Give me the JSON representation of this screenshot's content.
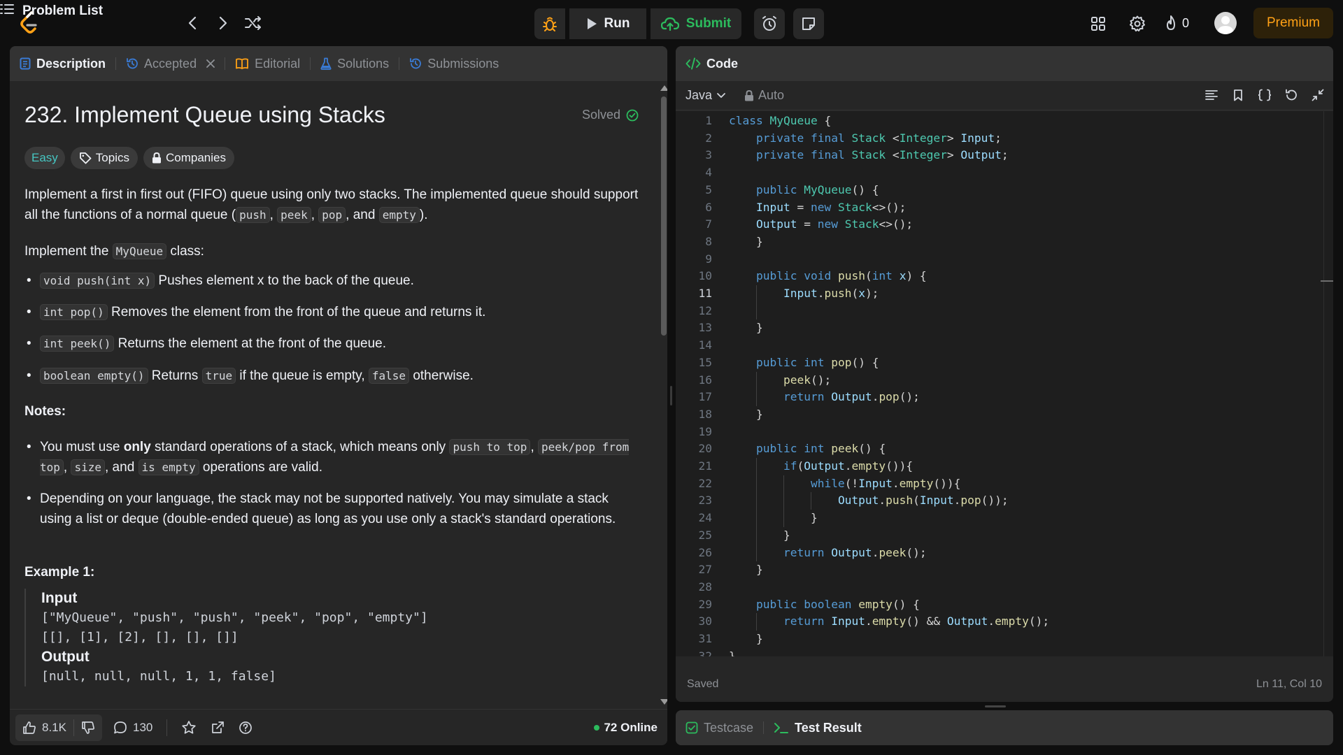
{
  "nav": {
    "problem_list": "Problem List",
    "run": "Run",
    "submit": "Submit",
    "streak_count": "0",
    "premium": "Premium"
  },
  "left_tabs": [
    {
      "label": "Description",
      "active": true
    },
    {
      "label": "Accepted",
      "active": false
    },
    {
      "label": "Editorial",
      "active": false
    },
    {
      "label": "Solutions",
      "active": false
    },
    {
      "label": "Submissions",
      "active": false
    }
  ],
  "problem": {
    "title": "232. Implement Queue using Stacks",
    "status": "Solved",
    "difficulty": "Easy",
    "topics": "Topics",
    "companies": "Companies",
    "intro_1": "Implement a first in first out (FIFO) queue using only two stacks. The implemented queue should support all the functions of a normal queue (",
    "code_push": "push",
    "code_peek": "peek",
    "code_pop": "pop",
    "code_empty": "empty",
    "intro_sep": ", ",
    "intro_and": ", and ",
    "intro_end": ").",
    "implement_pre": "Implement the ",
    "class_name": "MyQueue",
    "implement_post": " class:",
    "methods": [
      {
        "code": "void push(int x)",
        "text": " Pushes element x to the back of the queue."
      },
      {
        "code": "int pop()",
        "text": " Removes the element from the front of the queue and returns it."
      },
      {
        "code": "int peek()",
        "text": " Returns the element at the front of the queue."
      }
    ],
    "empty_method": {
      "code": "boolean empty()",
      "pre": " Returns ",
      "true": "true",
      "mid": " if the queue is empty, ",
      "false": "false",
      "post": " otherwise."
    },
    "notes_title": "Notes:",
    "note1": {
      "pre": "You must use ",
      "bold": "only",
      "mid": " standard operations of a stack, which means only ",
      "c1": "push to top",
      "sep1": ", ",
      "c2": "peek/pop from top",
      "sep2": ", ",
      "c3": "size",
      "and": ", and ",
      "c4": "is empty",
      "post": " operations are valid."
    },
    "note2": "Depending on your language, the stack may not be supported natively. You may simulate a stack using a list or deque (double-ended queue) as long as you use only a stack's standard operations.",
    "example_title": "Example 1:",
    "input_label": "Input",
    "input_line1": "[\"MyQueue\", \"push\", \"push\", \"peek\", \"pop\", \"empty\"]",
    "input_line2": "[[], [1], [2], [], [], []]",
    "output_label": "Output",
    "output_line": "[null, null, null, 1, 1, false]"
  },
  "footer": {
    "likes": "8.1K",
    "comments": "130",
    "online": "72 Online"
  },
  "code_panel": {
    "title": "Code",
    "language": "Java",
    "mode": "Auto",
    "saved": "Saved",
    "cursor": "Ln 11, Col 10",
    "current_line": 11
  },
  "code_lines": [
    "class MyQueue {",
    "    private final Stack <Integer> Input;",
    "    private final Stack <Integer> Output;",
    "",
    "    public MyQueue() {",
    "    Input = new Stack<>();",
    "    Output = new Stack<>();",
    "    }",
    "",
    "    public void push(int x) {",
    "        Input.push(x);",
    "",
    "    }",
    "",
    "    public int pop() {",
    "        peek();",
    "        return Output.pop();",
    "    }",
    "",
    "    public int peek() {",
    "        if(Output.empty()){",
    "            while(!Input.empty()){",
    "                Output.push(Input.pop());",
    "            }",
    "        }",
    "        return Output.peek();",
    "    }",
    "",
    "    public boolean empty() {",
    "        return Input.empty() && Output.empty();",
    "    }",
    "}"
  ],
  "test_tabs": [
    {
      "label": "Testcase",
      "active": false
    },
    {
      "label": "Test Result",
      "active": true
    }
  ],
  "colors": {
    "accent_green": "#2cbb5d",
    "premium": "#ffa116",
    "easy": "#46c6c2",
    "tab_icon_blue": "#3a7bd5"
  }
}
